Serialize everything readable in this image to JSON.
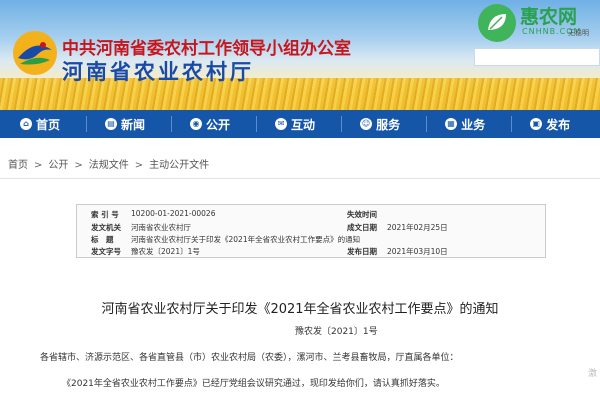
{
  "header": {
    "org_line": "中共河南省委农村工作领导小组办公室",
    "dept_line": "河南省农业农村厅",
    "site": {
      "name": "惠农网",
      "domain": "CNHNB.COM",
      "slogan": "无稳明"
    }
  },
  "nav": {
    "items": [
      {
        "label": "首页",
        "icon": "home-icon"
      },
      {
        "label": "新闻",
        "icon": "news-icon"
      },
      {
        "label": "公开",
        "icon": "public-icon"
      },
      {
        "label": "互动",
        "icon": "chat-icon"
      },
      {
        "label": "服务",
        "icon": "service-icon"
      },
      {
        "label": "业务",
        "icon": "business-icon"
      },
      {
        "label": "发布",
        "icon": "publish-icon"
      }
    ]
  },
  "breadcrumb": {
    "home": "首页",
    "sep": ">",
    "l1": "公开",
    "l2": "法规文件",
    "l3": "主动公开文件"
  },
  "meta": {
    "index_label": "索 引 号",
    "index_value": "10200-01-2021-00026",
    "issuer_label": "发文机关",
    "issuer_value": "河南省农业农村厅",
    "title_label": "标　题",
    "title_value": "河南省农业农村厅关于印发《2021年全省农业农村工作要点》的通知",
    "docno_label": "发文字号",
    "docno_value": "豫农发〔2021〕1号",
    "expiry_label": "失效时间",
    "expiry_value": "",
    "written_label": "成文日期",
    "written_value": "2021年02月25日",
    "published_label": "发布日期",
    "published_value": "2021年03月10日"
  },
  "doc": {
    "title": "河南省农业农村厅关于印发《2021年全省农业农村工作要点》的通知",
    "number": "豫农发〔2021〕1号",
    "para1": "各省辖市、济源示范区、各省直管县（市）农业农村局（农委），漯河市、兰考县畜牧局，厅直属各单位：",
    "para2": "《2021年全省农业农村工作要点》已经厅党组会议研究通过，现印发给你们，请认真抓好落实。",
    "side_mark": "激"
  }
}
